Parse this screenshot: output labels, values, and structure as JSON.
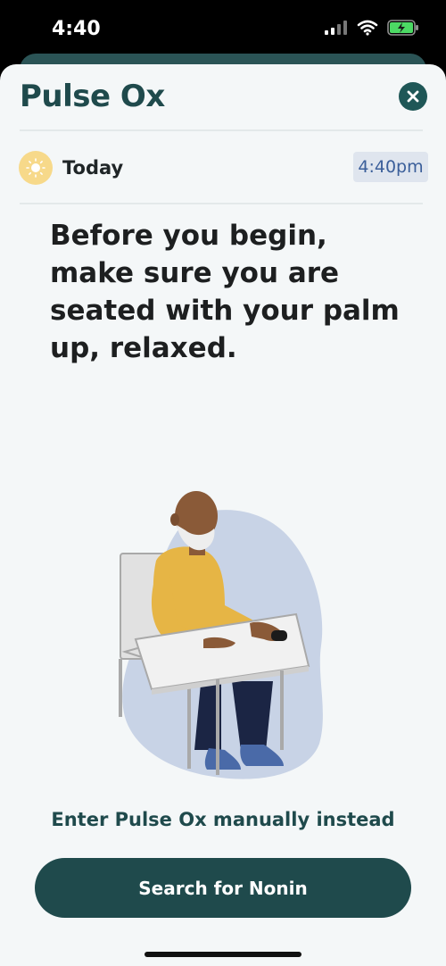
{
  "status_bar": {
    "time": "4:40"
  },
  "header": {
    "title": "Pulse Ox",
    "close_icon": "close-icon"
  },
  "date_row": {
    "label": "Today",
    "time": "4:40pm",
    "icon": "sun-icon"
  },
  "instruction": "Before you begin, make sure you are seated with your palm up, relaxed.",
  "illustration": {
    "icon": "person-seated-with-pulse-oximeter"
  },
  "actions": {
    "manual_entry": "Enter Pulse Ox manually instead",
    "search_button": "Search for Nonin"
  },
  "colors": {
    "primary": "#1f4a4c",
    "background": "#f4f7f8",
    "sun": "#f7d98a",
    "time_chip": "#dfe5ee"
  }
}
